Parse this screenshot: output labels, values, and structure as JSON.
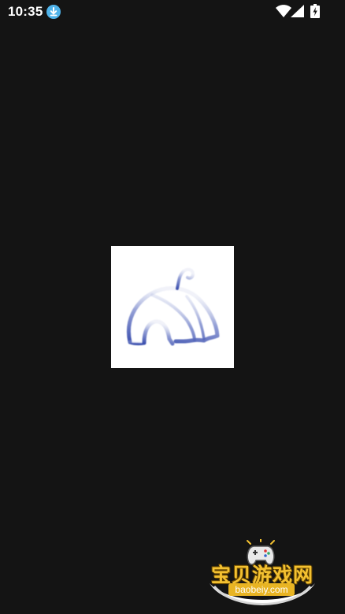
{
  "status_bar": {
    "time": "10:35",
    "icons": [
      "download-notification-icon",
      "wifi-icon",
      "cellular-signal-icon",
      "battery-charging-icon"
    ]
  },
  "splash": {
    "logo_icon": "igloo-tent-logo-icon",
    "logo_color": "#3b4fae"
  },
  "watermark": {
    "title": "宝贝游戏网",
    "url": "baobeiy.com",
    "icon": "game-controller-icon",
    "colors": {
      "title": "#f3c131",
      "badge": "#e8b423"
    }
  },
  "theme": {
    "background": "#141414"
  }
}
